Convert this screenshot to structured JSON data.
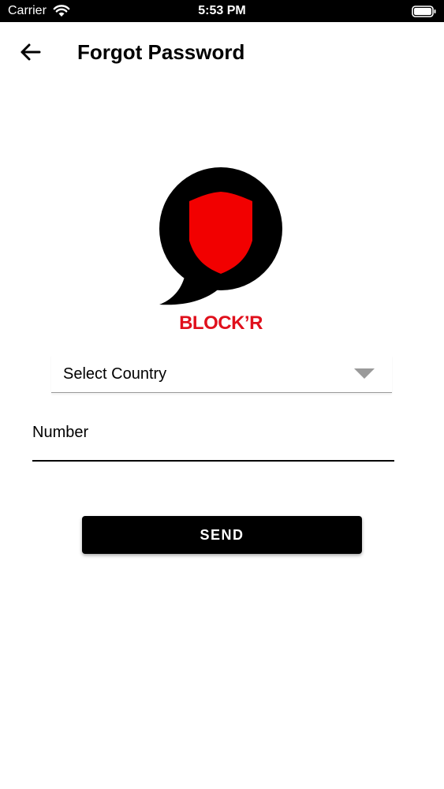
{
  "status_bar": {
    "carrier": "Carrier",
    "time": "5:53 PM"
  },
  "header": {
    "title": "Forgot Password",
    "back_icon": "arrow-left-icon"
  },
  "logo": {
    "text": "BLOCK’R",
    "shield_color": "#f20000",
    "text_color": "#e0101c"
  },
  "form": {
    "country_select": {
      "selected": "Select Country"
    },
    "number_field": {
      "placeholder": "Number",
      "value": ""
    },
    "send_label": "SEND"
  },
  "colors": {
    "primary": "#000000",
    "accent": "#e0101c",
    "background": "#ffffff"
  }
}
